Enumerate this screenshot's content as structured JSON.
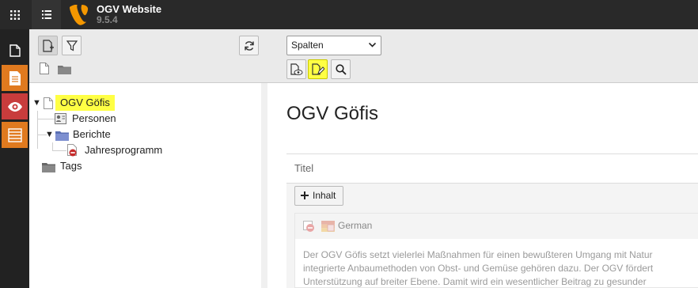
{
  "topbar": {
    "site_name": "OGV Website",
    "version": "9.5.4",
    "brand_color": "#f49700"
  },
  "modules": [
    {
      "name": "page-module",
      "color": "#222222"
    },
    {
      "name": "list-module",
      "color": "#e07a1f"
    },
    {
      "name": "view-module",
      "color": "#c83c3c"
    },
    {
      "name": "records-module",
      "color": "#e07a1f"
    }
  ],
  "tree": {
    "root": {
      "label": "OGV Göfis",
      "highlight": "#ffff44"
    },
    "items": [
      {
        "label": "Personen"
      },
      {
        "label": "Berichte"
      },
      {
        "label": "Jahresprogramm"
      },
      {
        "label": "Tags"
      }
    ]
  },
  "docheader": {
    "view_select": "Spalten",
    "highlight": "#ffff44"
  },
  "content": {
    "page_title": "OGV Göfis",
    "column_title": "Titel",
    "add_content_label": "Inhalt",
    "language": "German",
    "text_lines": [
      "Der OGV Göfis setzt vielerlei Maßnahmen für einen bewußteren Umgang mit Natur",
      "integrierte Anbaumethoden von Obst- und Gemüse gehören dazu. Der OGV fördert",
      "Unterstützung auf breiter Ebene. Damit wird ein wesentlicher Beitrag zu gesunder"
    ]
  }
}
